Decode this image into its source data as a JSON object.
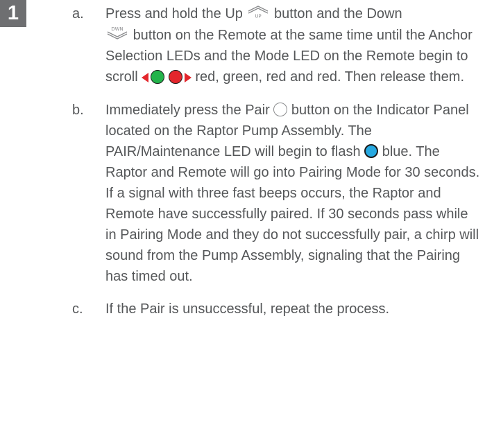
{
  "step_number": "1",
  "colors": {
    "badge": "#6e6f71",
    "text": "#555759",
    "led_green": "#24b34b",
    "led_red": "#e3262c",
    "led_blue": "#27a9e1"
  },
  "steps": [
    {
      "letter": "a.",
      "part1": "Press and hold the Up",
      "up_icon_label": "UP",
      "part2": "button and the Down",
      "down_icon_label": "DWN",
      "part3": "button on the Remote at the same time until the Anchor Selection LEDs and the Mode LED on the Remote begin to scroll",
      "part4": "red, green, red and red. Then release them."
    },
    {
      "letter": "b.",
      "part1": "Immediately press the Pair",
      "part2": "button on the Indicator Panel located on the Raptor Pump Assembly. The PAIR/Maintenance LED will begin to flash",
      "part3": "blue. The Raptor and Remote will go into Pairing Mode for 30 seconds. If a signal with three fast beeps occurs, the Raptor and Remote have successfully paired. If 30 seconds pass while in Pairing Mode and they do not successfully pair, a chirp will sound from the Pump Assembly, signaling that the Pairing has timed out."
    },
    {
      "letter": "c.",
      "text": "If the Pair is unsuccessful, repeat the process."
    }
  ]
}
